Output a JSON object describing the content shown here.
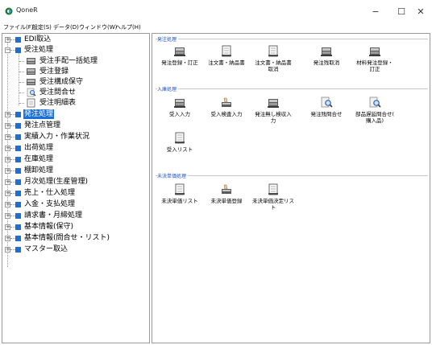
{
  "app": {
    "title": "QoneR",
    "minimize": "−",
    "maximize": "☐",
    "close": "✕"
  },
  "menu": {
    "items": [
      "ファイル(F)",
      "設定(S)",
      "データ(D)",
      "ウィンドウ(W)",
      "ヘルプ(H)"
    ]
  },
  "tree": {
    "nodes": [
      {
        "label": "EDI取込",
        "expanded": false
      },
      {
        "label": "受注処理",
        "expanded": true
      },
      {
        "label": "受注手配一括処理"
      },
      {
        "label": "受注登録"
      },
      {
        "label": "受注構成保守"
      },
      {
        "label": "受注問合せ"
      },
      {
        "label": "受注明細表"
      },
      {
        "label": "発注処理",
        "selected": true
      },
      {
        "label": "発注点管理"
      },
      {
        "label": "実績入力・作業状況"
      },
      {
        "label": "出荷処理"
      },
      {
        "label": "在庫処理"
      },
      {
        "label": "棚卸処理"
      },
      {
        "label": "月次処理(生産管理)"
      },
      {
        "label": "売上・仕入処理"
      },
      {
        "label": "入金・支払処理"
      },
      {
        "label": "請求書・月締処理"
      },
      {
        "label": "基本情報(保守)"
      },
      {
        "label": "基本情報(問合せ・リスト)"
      },
      {
        "label": "マスター取込"
      }
    ]
  },
  "groups": {
    "order": {
      "title": "発注処理",
      "buttons": [
        {
          "label": "発注登録・訂正",
          "icon": "keyboard-icon"
        },
        {
          "label": "注文書・納品書",
          "icon": "document-icon"
        },
        {
          "label": "注文書・納品書\n取消",
          "icon": "document-icon"
        },
        {
          "label": "発注残取消",
          "icon": "keyboard-icon"
        },
        {
          "label": "材料発注登録・\n訂正",
          "icon": "keyboard-icon"
        }
      ]
    },
    "receiving": {
      "title": "入庫処理",
      "buttons": [
        {
          "label": "受入入力",
          "icon": "keyboard-icon"
        },
        {
          "label": "受入検査入力",
          "icon": "hand-keyboard-icon"
        },
        {
          "label": "発注無し検収入\n力",
          "icon": "keyboard-icon"
        },
        {
          "label": "発注残問合せ",
          "icon": "magnifier-doc-icon"
        },
        {
          "label": "部品遅延問合せ(\n購入品)",
          "icon": "magnifier-doc-icon"
        },
        {
          "label": "受入リスト",
          "icon": "document-icon"
        }
      ]
    },
    "unsettled": {
      "title": "未決単価処理",
      "buttons": [
        {
          "label": "未決単価リスト",
          "icon": "document-icon"
        },
        {
          "label": "未決単価登録",
          "icon": "hand-keyboard-icon"
        },
        {
          "label": "未決単価決定リス\nト",
          "icon": "document-icon"
        }
      ]
    }
  },
  "colors": {
    "accent": "#1a6fd8",
    "folder": "#1e6fd0",
    "group_title": "#1a4fc0"
  }
}
